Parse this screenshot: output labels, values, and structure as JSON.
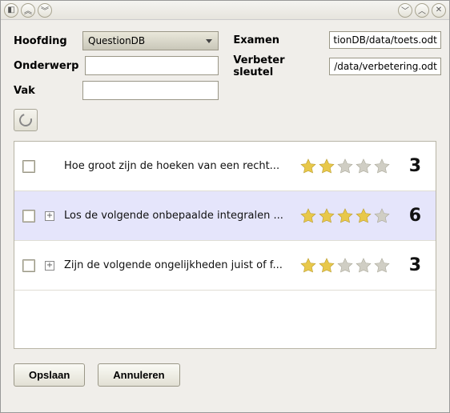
{
  "titlebar": {},
  "form": {
    "hoofding_label": "Hoofding",
    "hoofding_value": "QuestionDB",
    "onderwerp_label": "Onderwerp",
    "onderwerp_value": "",
    "vak_label": "Vak",
    "vak_value": "",
    "examen_label": "Examen",
    "examen_value": "tionDB/data/toets.odt",
    "verbeter_label": "Verbeter sleutel",
    "verbeter_value": "/data/verbetering.odt"
  },
  "questions": [
    {
      "text": "Hoe groot zijn de hoeken van een recht...",
      "rating": 2,
      "count": "3",
      "expandable": false,
      "selected": false
    },
    {
      "text": "Los de volgende onbepaalde integralen ...",
      "rating": 4,
      "count": "6",
      "expandable": true,
      "selected": true
    },
    {
      "text": "Zijn de volgende ongelijkheden juist of f...",
      "rating": 2,
      "count": "3",
      "expandable": true,
      "selected": false
    }
  ],
  "buttons": {
    "save": "Opslaan",
    "cancel": "Annuleren"
  }
}
